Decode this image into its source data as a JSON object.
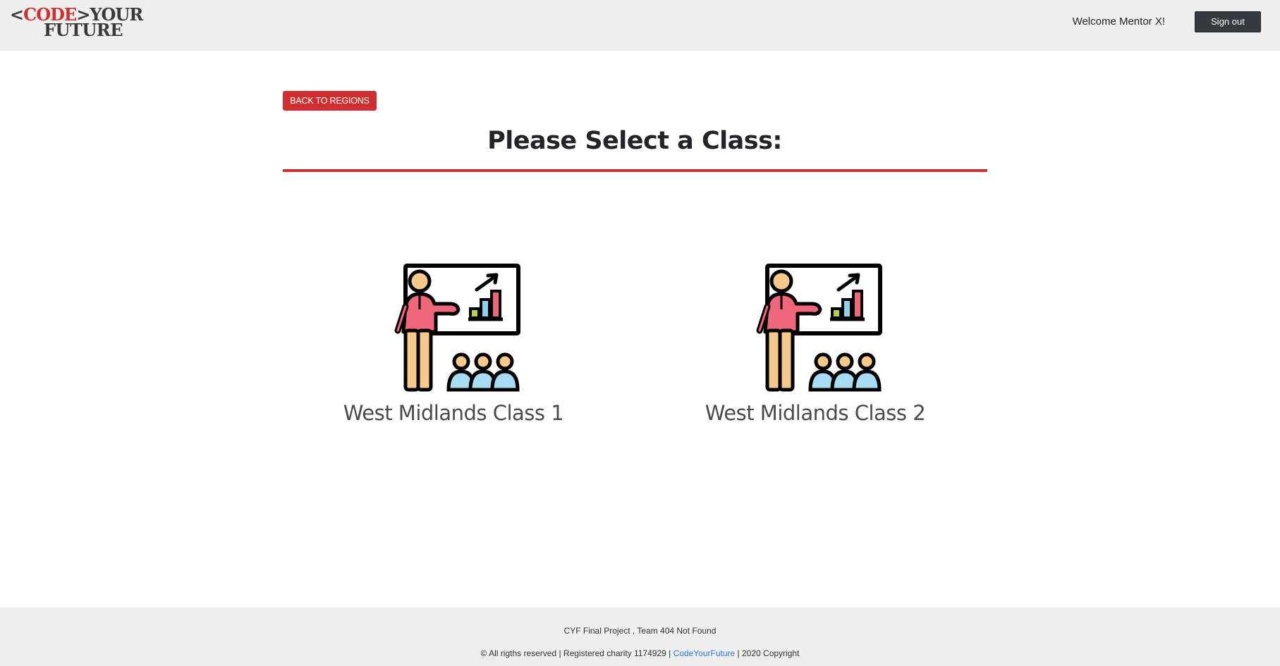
{
  "header": {
    "logo": {
      "part1": "<",
      "part2": "CODE",
      "part3": ">",
      "part4": "YOUR",
      "line2": "FUTURE"
    },
    "welcome": "Welcome Mentor X!",
    "signout_label": "Sign out"
  },
  "main": {
    "back_label": "BACK TO REGIONS",
    "title": "Please Select a Class:",
    "classes": [
      {
        "name": "West Midlands Class 1",
        "icon": "presentation-teacher-icon"
      },
      {
        "name": "West Midlands Class 2",
        "icon": "presentation-teacher-icon"
      }
    ]
  },
  "footer": {
    "line1": "CYF Final Project , Team 404 Not Found",
    "line2_prefix": "© All rigths reserved | Registered charity 1174929 | ",
    "link_label": "CodeYourFuture",
    "line2_suffix": " | 2020 Copyright"
  },
  "colors": {
    "accent": "#d12f2f",
    "header_bg": "#efefef",
    "signout_bg": "#343a40",
    "link": "#2a7ae2"
  }
}
